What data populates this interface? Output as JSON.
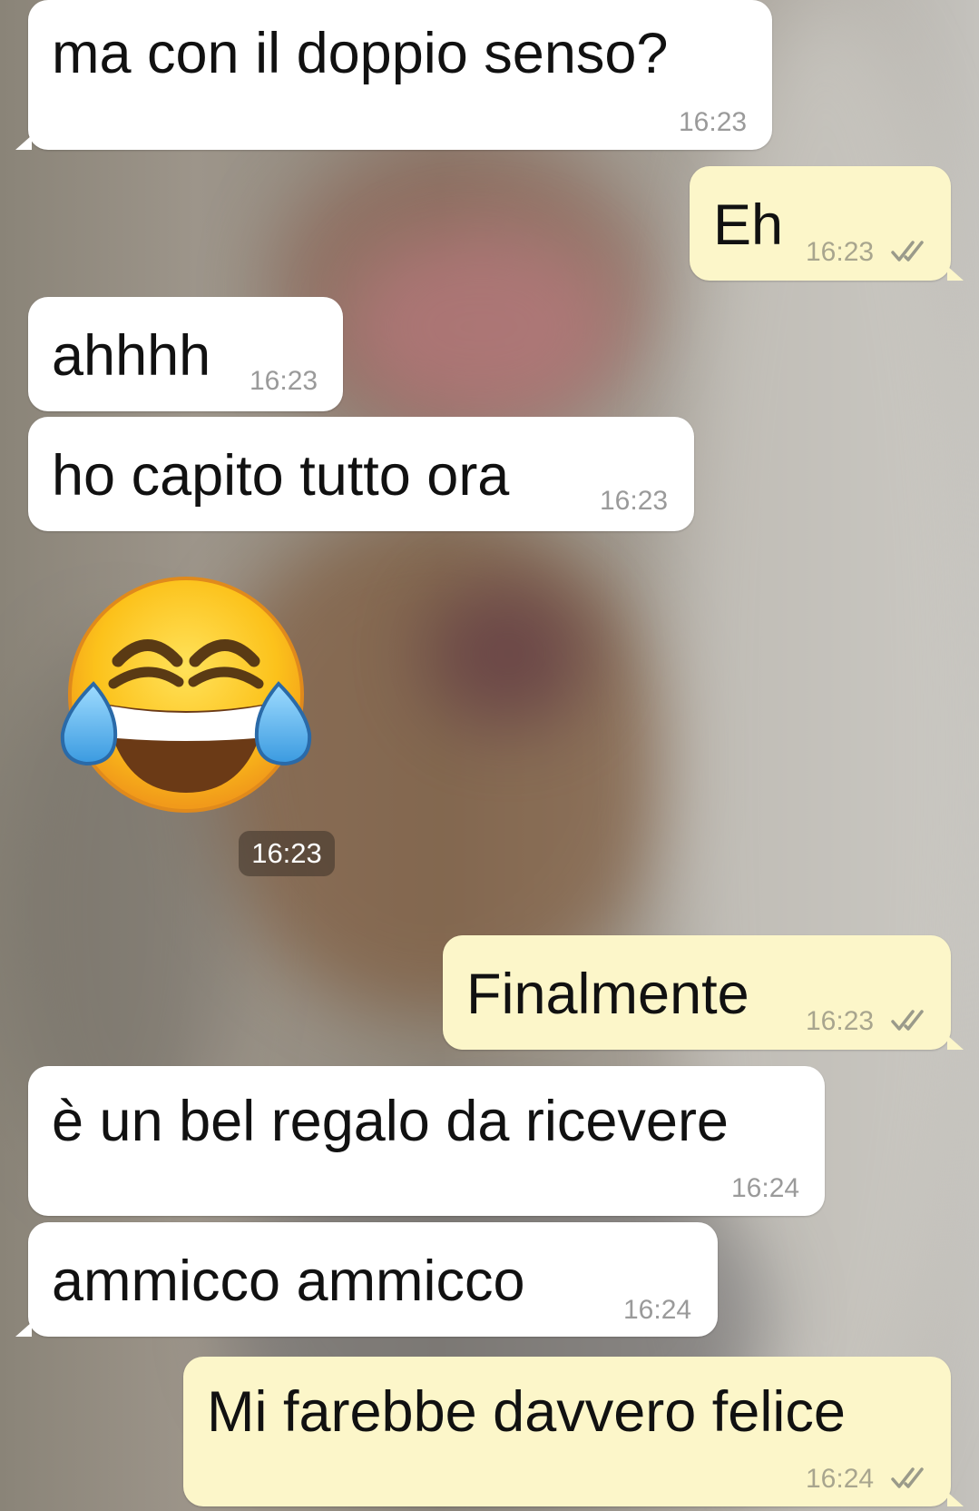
{
  "conversation": {
    "messages": [
      {
        "direction": "incoming",
        "text": "ma con il doppio senso?",
        "time": "16:23"
      },
      {
        "direction": "outgoing",
        "text": "Eh",
        "time": "16:23",
        "status": "read"
      },
      {
        "direction": "incoming",
        "text": "ahhhh",
        "time": "16:23"
      },
      {
        "direction": "incoming",
        "text": "ho capito tutto ora",
        "time": "16:23"
      },
      {
        "direction": "incoming",
        "emoji": "face-with-tears-of-joy",
        "time": "16:23"
      },
      {
        "direction": "outgoing",
        "text": "Finalmente",
        "time": "16:23",
        "status": "read"
      },
      {
        "direction": "incoming",
        "text": "è un bel regalo da ricevere",
        "time": "16:24"
      },
      {
        "direction": "incoming",
        "text": "ammicco ammicco",
        "time": "16:24"
      },
      {
        "direction": "outgoing",
        "text": "Mi farebbe davvero felice",
        "time": "16:24",
        "status": "read"
      }
    ]
  },
  "colors": {
    "incoming_bubble": "#ffffff",
    "outgoing_bubble": "#fcf6c9",
    "read_ticks": "#9a9a8a",
    "timestamp": "#9a9a9a"
  }
}
